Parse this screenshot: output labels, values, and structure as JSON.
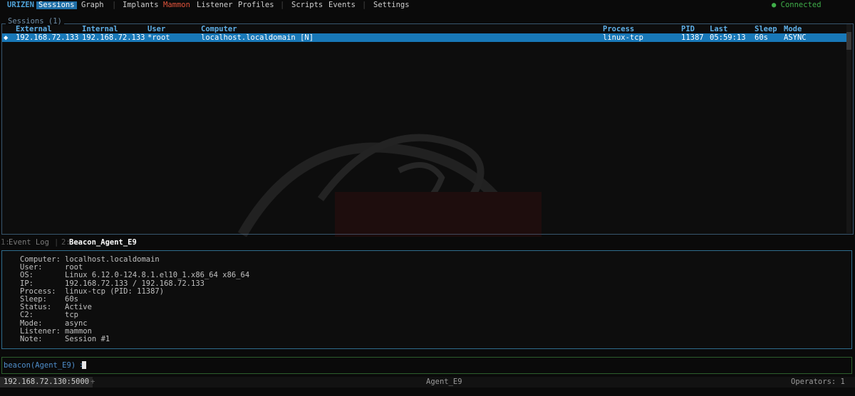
{
  "menu": {
    "brand": "URIZEN",
    "items": [
      "Sessions",
      "Graph",
      "Implants",
      "Mammon",
      "Listener",
      "Profiles",
      "Scripts",
      "Events",
      "Settings"
    ],
    "separator": "|",
    "status": "● Connected"
  },
  "sessions": {
    "title": "Sessions (1)",
    "columns": [
      "External",
      "Internal",
      "User",
      "Computer",
      "Process",
      "PID",
      "Last",
      "Sleep",
      "Mode"
    ],
    "rows": [
      {
        "marker": "◆",
        "external": "192.168.72.133",
        "internal": "192.168.72.133",
        "user": "*root",
        "computer": "localhost.localdomain [N]",
        "process": "linux-tcp",
        "pid": "11387",
        "last": "05:59:13",
        "sleep": "60s",
        "mode": "ASYNC"
      }
    ]
  },
  "tabs": [
    {
      "num": "1:",
      "label": "Event Log"
    },
    {
      "num": "2:",
      "label": "Beacon_Agent_E9"
    }
  ],
  "info": [
    {
      "key": "Computer:",
      "value": "localhost.localdomain"
    },
    {
      "key": "User:",
      "value": "root"
    },
    {
      "key": "OS:",
      "value": "Linux 6.12.0-124.8.1.el10_1.x86_64 x86_64"
    },
    {
      "key": "IP:",
      "value": "192.168.72.133 / 192.168.72.133"
    },
    {
      "key": "Process:",
      "value": "linux-tcp (PID: 11387)"
    },
    {
      "key": "Sleep:",
      "value": "60s"
    },
    {
      "key": "Status:",
      "value": "Active"
    },
    {
      "key": "C2:",
      "value": "tcp"
    },
    {
      "key": "Mode:",
      "value": "async"
    },
    {
      "key": "Listener:",
      "value": "mammon"
    },
    {
      "key": "Note:",
      "value": "Session #1"
    }
  ],
  "command": {
    "prompt": "beacon(Agent_E9) >",
    "value": ""
  },
  "statusbar": {
    "address": "192.168.72.130:5000",
    "plus": "+",
    "agent": "Agent_E9",
    "operators": "Operators: 1"
  },
  "colors": {
    "accent": "#1878b8",
    "brand": "#4fa3d9",
    "warning": "#e0533b",
    "connected": "#3fae49",
    "header": "#5fb0e8"
  }
}
